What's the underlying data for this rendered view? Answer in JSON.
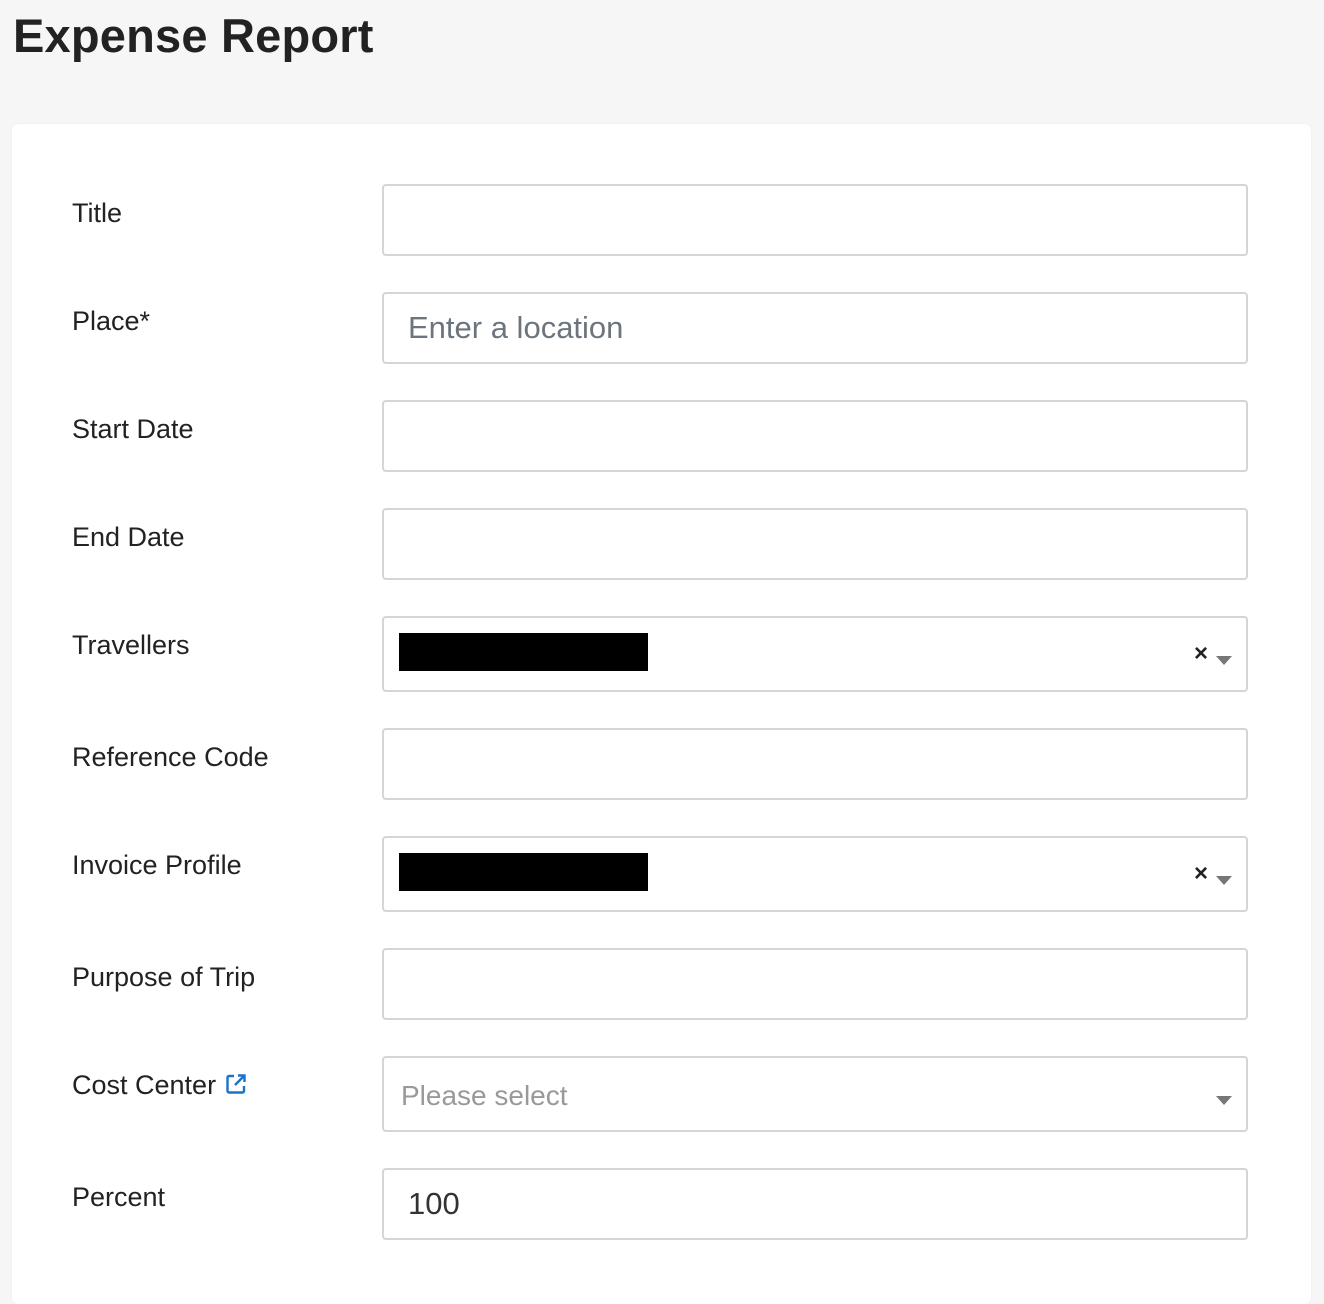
{
  "page": {
    "title": "Expense Report"
  },
  "form": {
    "title": {
      "label": "Title",
      "value": ""
    },
    "place": {
      "label": "Place*",
      "placeholder": "Enter a location",
      "value": ""
    },
    "start_date": {
      "label": "Start Date",
      "value": ""
    },
    "end_date": {
      "label": "End Date",
      "value": ""
    },
    "travellers": {
      "label": "Travellers",
      "clear_symbol": "×"
    },
    "reference_code": {
      "label": "Reference Code",
      "value": ""
    },
    "invoice_profile": {
      "label": "Invoice Profile",
      "clear_symbol": "×"
    },
    "purpose_of_trip": {
      "label": "Purpose of Trip",
      "value": ""
    },
    "cost_center": {
      "label": "Cost Center",
      "placeholder": "Please select",
      "link_icon": "external-link-icon"
    },
    "percent": {
      "label": "Percent",
      "value": "100"
    }
  },
  "colors": {
    "background": "#f6f6f6",
    "card": "#ffffff",
    "border": "#d5d5d5",
    "link_icon": "#1a73c9",
    "redaction": "#000000"
  }
}
